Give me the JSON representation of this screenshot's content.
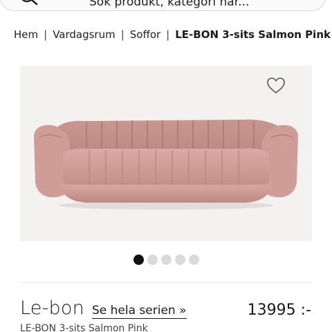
{
  "search": {
    "placeholder": "Sök produkt, kategori här..."
  },
  "breadcrumb": {
    "items": [
      "Hem",
      "Vardagsrum",
      "Soffor"
    ],
    "current": "LE-BON 3-sits Salmon Pink",
    "separator": "|"
  },
  "product": {
    "image_alt": "LE-BON 3-sits Salmon Pink",
    "sofa_color": "#d4a29c",
    "gallery": {
      "count": 5,
      "active_index": 0
    },
    "brand": "Le-bon",
    "series_link": "Se hela serien »",
    "price": "13995 :-",
    "name": "LE-BON 3-sits Salmon Pink"
  },
  "icons": {
    "search": "search-icon",
    "wishlist": "heart-outline-icon"
  }
}
